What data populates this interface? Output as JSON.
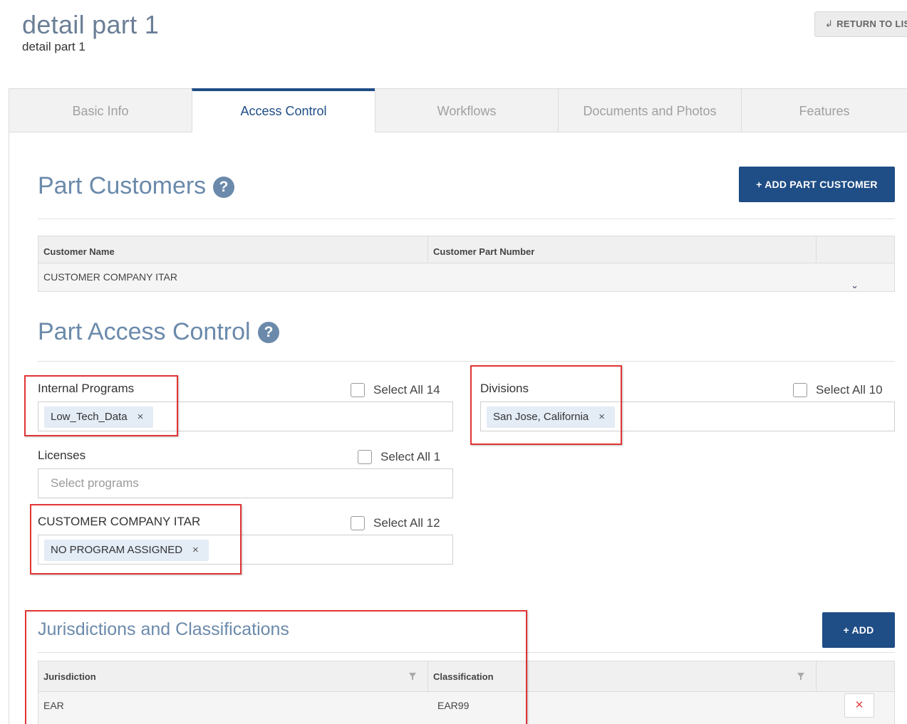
{
  "page": {
    "title": "detail part 1",
    "subtitle": "detail part 1",
    "return_label": "RETURN TO LIS",
    "return_icon": "↲"
  },
  "tabs": [
    {
      "label": "Basic Info",
      "active": false
    },
    {
      "label": "Access Control",
      "active": true
    },
    {
      "label": "Workflows",
      "active": false
    },
    {
      "label": "Documents and Photos",
      "active": false
    },
    {
      "label": "Features",
      "active": false
    }
  ],
  "part_customers": {
    "title": "Part Customers",
    "help": "?",
    "add_button": "+ ADD PART CUSTOMER",
    "columns": [
      "Customer Name",
      "Customer Part Number"
    ],
    "rows": [
      {
        "customer_name": "CUSTOMER COMPANY ITAR",
        "customer_part_number": "",
        "expand": "⌄"
      }
    ]
  },
  "access_control": {
    "title": "Part Access Control",
    "help": "?",
    "internal_programs": {
      "label": "Internal Programs",
      "select_all": "Select All 14",
      "chips": [
        "Low_Tech_Data"
      ]
    },
    "divisions": {
      "label": "Divisions",
      "select_all": "Select All 10",
      "chips": [
        "San Jose, California"
      ]
    },
    "licenses": {
      "label": "Licenses",
      "select_all": "Select All 1",
      "placeholder": "Select programs"
    },
    "customer_itar": {
      "label": "CUSTOMER COMPANY ITAR",
      "select_all": "Select All 12",
      "chips": [
        "NO PROGRAM ASSIGNED"
      ]
    },
    "chip_remove": "×"
  },
  "jurisdictions": {
    "title": "Jurisdictions and Classifications",
    "add_button": "+ ADD",
    "columns": [
      "Jurisdiction",
      "Classification"
    ],
    "rows": [
      {
        "jurisdiction": "EAR",
        "classification": "EAR99",
        "delete": "✕"
      }
    ]
  },
  "colors": {
    "accent": "#1f4d85",
    "section_title": "#6b8aab",
    "highlight_box": "#e23434",
    "chip_bg": "#e4ecf6"
  }
}
